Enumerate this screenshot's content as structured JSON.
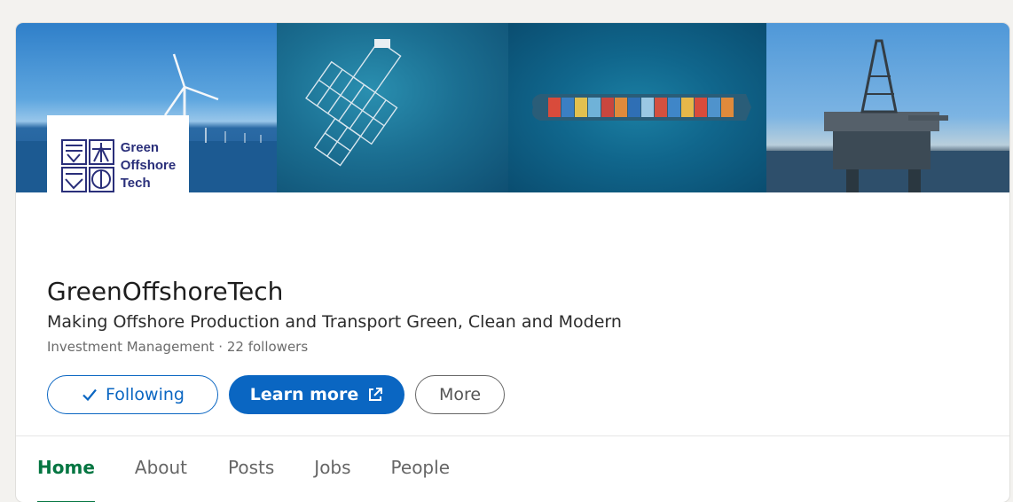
{
  "company": {
    "logo_text": [
      "Green",
      "Offshore",
      "Tech"
    ],
    "name": "GreenOffshoreTech",
    "tagline": "Making Offshore Production and Transport Green, Clean and Modern",
    "meta": "Investment Management · 22 followers"
  },
  "actions": {
    "following_label": "Following",
    "learn_more_label": "Learn more",
    "more_label": "More"
  },
  "tabs": [
    {
      "label": "Home",
      "active": true
    },
    {
      "label": "About",
      "active": false
    },
    {
      "label": "Posts",
      "active": false
    },
    {
      "label": "Jobs",
      "active": false
    },
    {
      "label": "People",
      "active": false
    }
  ],
  "colors": {
    "primary_blue": "#0a66c2",
    "active_tab_green": "#057642",
    "logo_navy": "#2a2f7a"
  },
  "icons": [
    "check-icon",
    "external-link-icon",
    "wind-turbine",
    "fish-farm",
    "container-ship",
    "oil-rig"
  ]
}
